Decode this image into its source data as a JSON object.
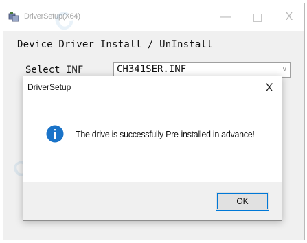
{
  "window": {
    "title": "DriverSetup(X64)",
    "heading": "Device Driver Install / UnInstall",
    "inf_label": "Select INF",
    "inf_value": "CH341SER.INF",
    "caption_min": "—",
    "caption_close": "X"
  },
  "dialog": {
    "title": "DriverSetup",
    "close_label": "X",
    "message": "The drive is successfully Pre-installed in advance!",
    "ok_label": "OK",
    "icon": "info-icon"
  },
  "colors": {
    "accent": "#0078d7",
    "info_icon": "#1a73c8",
    "watermark": "#4696cd"
  }
}
